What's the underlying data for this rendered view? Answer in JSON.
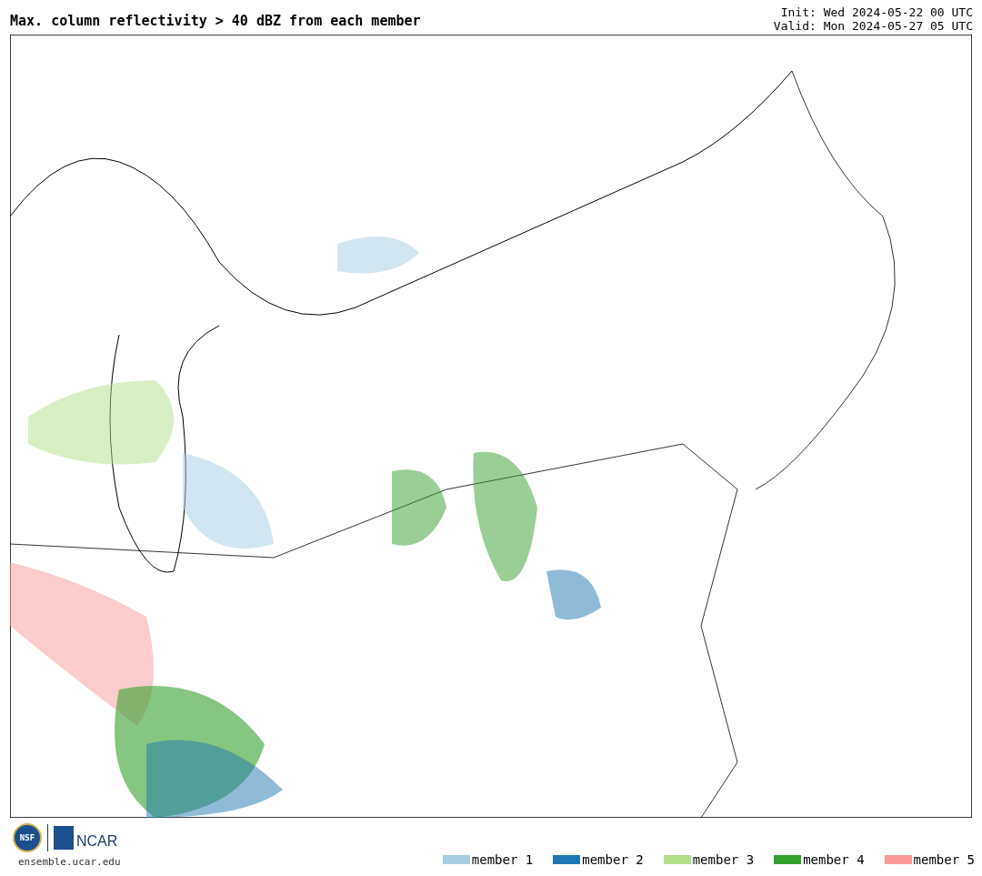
{
  "title": "Max. column reflectivity > 40 dBZ from each member",
  "init": "Init: Wed 2024-05-22 00 UTC",
  "valid": "Valid: Mon 2024-05-27 05 UTC",
  "logos": {
    "nsf": "NSF",
    "ncar": "NCAR"
  },
  "site": "ensemble.ucar.edu",
  "legend": [
    {
      "label": "member 1",
      "color": "#a6cee3"
    },
    {
      "label": "member 2",
      "color": "#1f78b4"
    },
    {
      "label": "member 3",
      "color": "#b2df8a"
    },
    {
      "label": "member 4",
      "color": "#33a02c"
    },
    {
      "label": "member 5",
      "color": "#fb9a99"
    }
  ]
}
